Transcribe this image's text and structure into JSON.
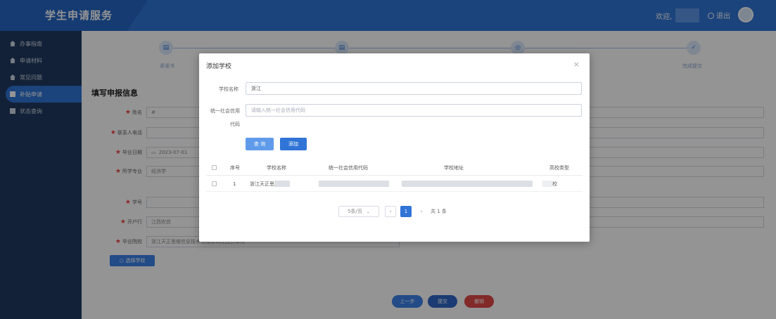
{
  "header": {
    "app_title": "学生申请服务",
    "welcome": "欢迎,",
    "logout": "退出"
  },
  "sidebar": {
    "items": [
      {
        "label": "办事指南"
      },
      {
        "label": "申请材料"
      },
      {
        "label": "常见问题"
      },
      {
        "label": "补贴申请"
      },
      {
        "label": "状态查询"
      }
    ]
  },
  "steps": {
    "labels": [
      "承诺书",
      "完成提交"
    ]
  },
  "form": {
    "section_title": "填写申报信息",
    "name_label": "姓名",
    "name_value": "#",
    "phone_label": "联系人电话",
    "grad_date_label": "毕业日期",
    "grad_date_value": "2023-07-01",
    "major_label": "所学专业",
    "major_value": "经济学",
    "student_id_label": "学号",
    "bank_label": "开户行",
    "bank_value": "江西农信",
    "school_label": "毕业院校",
    "school_value": "浙江天正思维信息技术有限公司江西分公司",
    "select_school_button": "选择学校",
    "prev_button": "上一步",
    "submit_button": "提交",
    "cancel_button": "撤销"
  },
  "modal": {
    "title": "添加学校",
    "close": "×",
    "school_name_label": "学校名称",
    "school_name_value": "浙江",
    "credit_code_label_1": "统一社会信用",
    "credit_code_label_2": "代码",
    "credit_code_placeholder": "请输入统一社会信用代码",
    "query_button": "查 询",
    "add_button": "添加",
    "table": {
      "columns": [
        "序号",
        "学校名称",
        "统一社会信用代码",
        "学校地址",
        "高校类型"
      ],
      "rows": [
        {
          "index": "1",
          "school_name": "浙江天正思",
          "school_type_tail": "校"
        }
      ]
    },
    "pagination": {
      "page_size": "5条/页",
      "current_page": "1",
      "total": "共 1 条"
    }
  }
}
